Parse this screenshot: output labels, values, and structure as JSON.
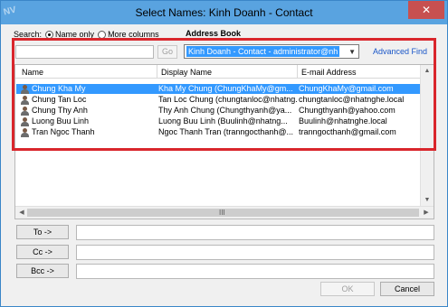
{
  "window": {
    "title": "Select Names: Kinh Doanh - Contact",
    "watermark": "NV",
    "close_glyph": "✕"
  },
  "search": {
    "label": "Search:",
    "option_name_only": "Name only",
    "option_more_columns": "More columns",
    "address_book_label": "Address Book",
    "query": "",
    "go_label": "Go",
    "address_book_value": "Kinh Doanh - Contact - administrator@nh",
    "advanced_find": "Advanced Find"
  },
  "list": {
    "columns": [
      "Name",
      "Display Name",
      "E-mail Address"
    ],
    "rows": [
      {
        "name": "Chung Kha My",
        "display": "Kha My Chung (ChungKhaMy@gm...",
        "email": "ChungKhaMy@gmail.com"
      },
      {
        "name": "Chung Tan Loc",
        "display": "Tan Loc Chung (chungtanloc@nhatng...",
        "email": "chungtanloc@nhatnghe.local"
      },
      {
        "name": "Chung Thy Anh",
        "display": "Thy Anh Chung (Chungthyanh@ya...",
        "email": "Chungthyanh@yahoo.com"
      },
      {
        "name": "Luong Buu Linh",
        "display": "Luong Buu Linh (Buulinh@nhatng...",
        "email": "Buulinh@nhatnghe.local"
      },
      {
        "name": "Tran Ngoc Thanh",
        "display": "Ngoc Thanh Tran (tranngocthanh@...",
        "email": "tranngocthanh@gmail.com"
      }
    ],
    "selected_index": 0,
    "scroll_grip": "III"
  },
  "recipients": {
    "to_label": "To ->",
    "cc_label": "Cc ->",
    "bcc_label": "Bcc ->",
    "to_value": "",
    "cc_value": "",
    "bcc_value": ""
  },
  "buttons": {
    "ok": "OK",
    "cancel": "Cancel"
  },
  "colors": {
    "title_bar": "#59a3e0",
    "selection": "#3399ff",
    "highlight_frame": "#d9262c",
    "link": "#1a56c8"
  }
}
